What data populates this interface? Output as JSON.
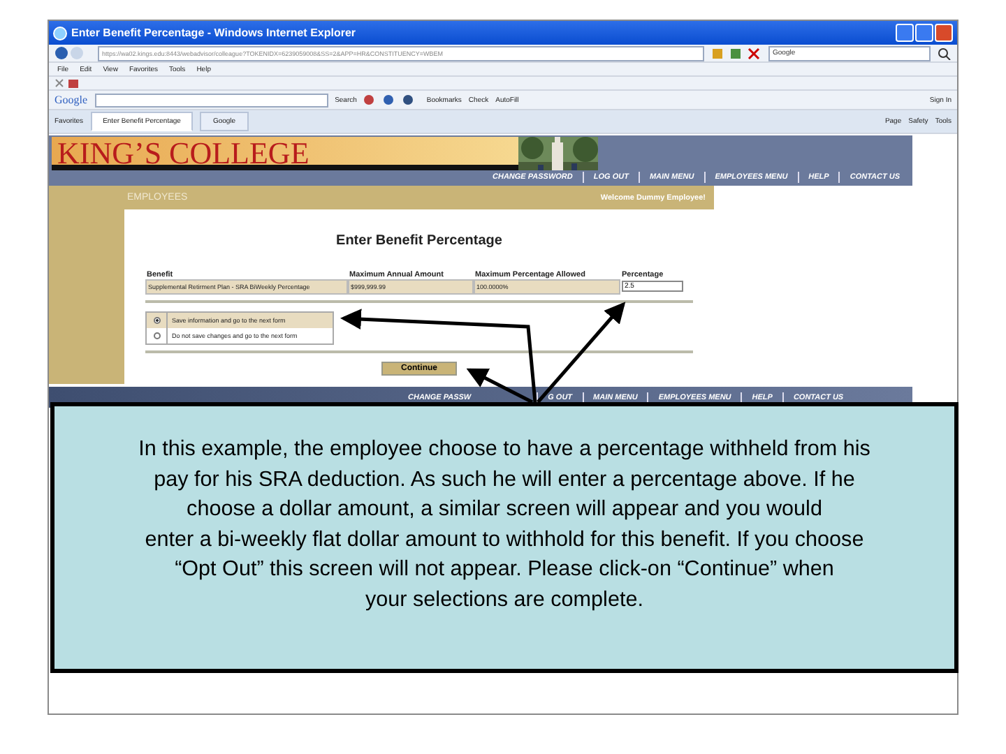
{
  "window": {
    "title": "Enter Benefit Percentage - Windows Internet Explorer"
  },
  "address_bar": {
    "url": "https://wa02.kings.edu:8443/webadvisor/colleague?TOKENIDX=6239059008&SS=2&APP=HR&CONSTITUENCY=WBEM",
    "search_placeholder": "Google"
  },
  "menu_bar": [
    "File",
    "Edit",
    "View",
    "Favorites",
    "Tools",
    "Help"
  ],
  "google_toolbar": {
    "logo": "Google",
    "search_button": "Search",
    "items": [
      "Bookmarks",
      "Check",
      "AutoFill"
    ],
    "sign_in": "Sign In"
  },
  "favorites_bar": {
    "favorites": "Favorites",
    "tabs": [
      {
        "label": "Enter Benefit Percentage",
        "selected": true
      },
      {
        "label": "Google",
        "selected": false
      }
    ],
    "commands": [
      "Page",
      "Safety",
      "Tools"
    ]
  },
  "site": {
    "logo": "KING’S COLLEGE",
    "nav": [
      "CHANGE PASSWORD",
      "LOG OUT",
      "MAIN MENU",
      "EMPLOYEES MENU",
      "HELP",
      "CONTACT US"
    ],
    "section": "EMPLOYEES",
    "welcome": "Welcome Dummy Employee!",
    "heading": "Enter Benefit Percentage",
    "table": {
      "columns": [
        "Benefit",
        "Maximum Annual Amount",
        "Maximum Percentage Allowed",
        "Percentage"
      ],
      "rows": [
        {
          "benefit": "Supplemental Retirment Plan - SRA BiWeekly Percentage",
          "max_amount": "$999,999.99",
          "max_percentage": "100.0000%",
          "percentage": "2.5"
        }
      ]
    },
    "options": [
      {
        "label": "Save information and go to the next form",
        "selected": true
      },
      {
        "label": "Do not save changes and go to the next form",
        "selected": false
      }
    ],
    "continue_button": "Continue",
    "bottom_nav": [
      "CHANGE PASSW",
      "G OUT",
      "MAIN MENU",
      "EMPLOYEES MENU",
      "HELP",
      "CONTACT US"
    ]
  },
  "callout": {
    "text": "In this example, the employee choose to have a percentage withheld from his\npay for his SRA deduction.  As such he will enter a percentage above.  If he\nchoose a dollar amount, a similar screen will appear and you would\nenter a bi-weekly flat dollar amount to withhold for this benefit.  If you choose\n“Opt Out” this screen will not appear. Please click-on “Continue” when\nyour selections are complete."
  }
}
